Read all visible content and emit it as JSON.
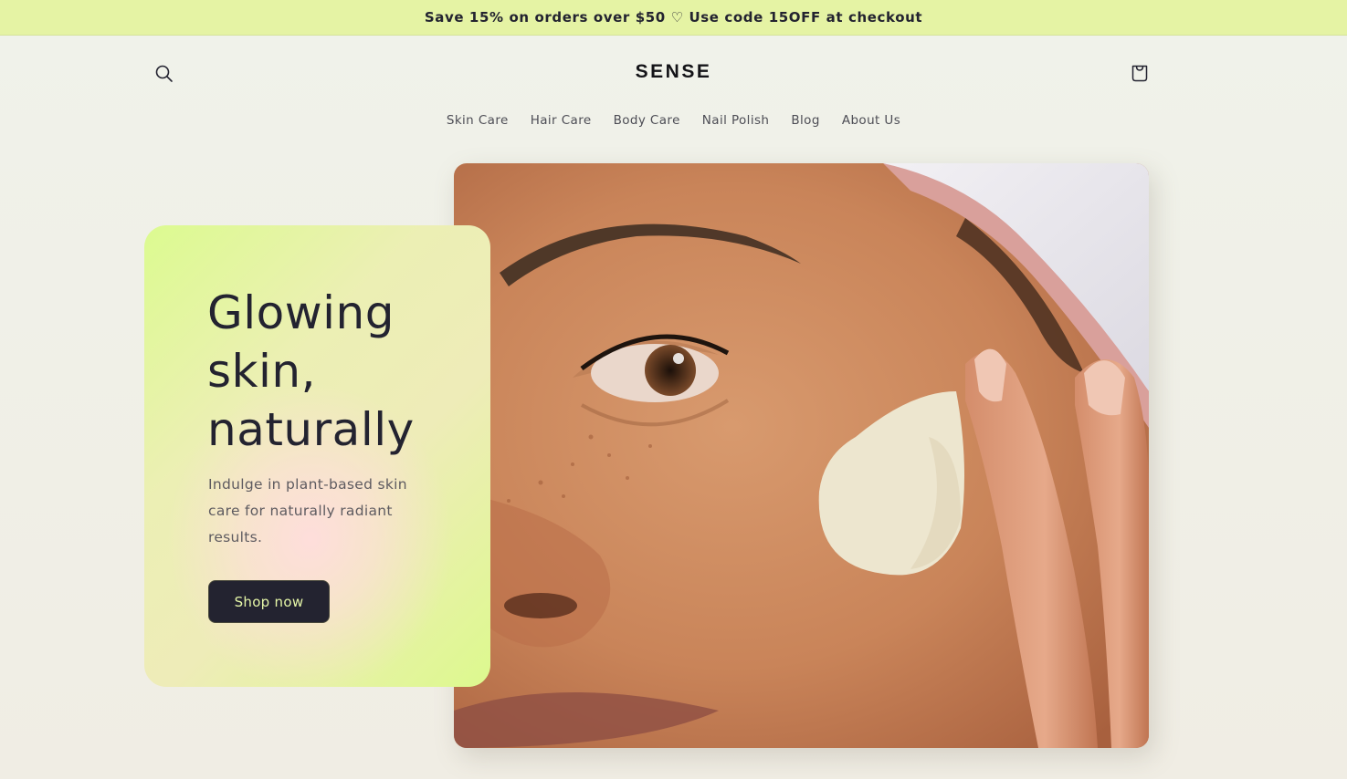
{
  "announcement": {
    "text": "Save 15% on orders over $50 ♡ Use code 15OFF at checkout"
  },
  "header": {
    "logo": "SENSE",
    "search_icon": "search-icon",
    "cart_icon": "cart-icon"
  },
  "nav": {
    "items": [
      {
        "label": "Skin Care"
      },
      {
        "label": "Hair Care"
      },
      {
        "label": "Body Care"
      },
      {
        "label": "Nail Polish"
      },
      {
        "label": "Blog"
      },
      {
        "label": "About Us"
      }
    ]
  },
  "hero": {
    "title": "Glowing skin, naturally",
    "description": "Indulge in plant-based skin care for naturally radiant results.",
    "cta_label": "Shop now",
    "image_alt": "Close-up of a woman applying cream to her cheek"
  },
  "colors": {
    "announcement_bg": "#e5f3a4",
    "accent_lime": "#dcfb90",
    "accent_pink": "#ffdddd",
    "dark": "#232330",
    "button_text": "#e6f7a8"
  }
}
